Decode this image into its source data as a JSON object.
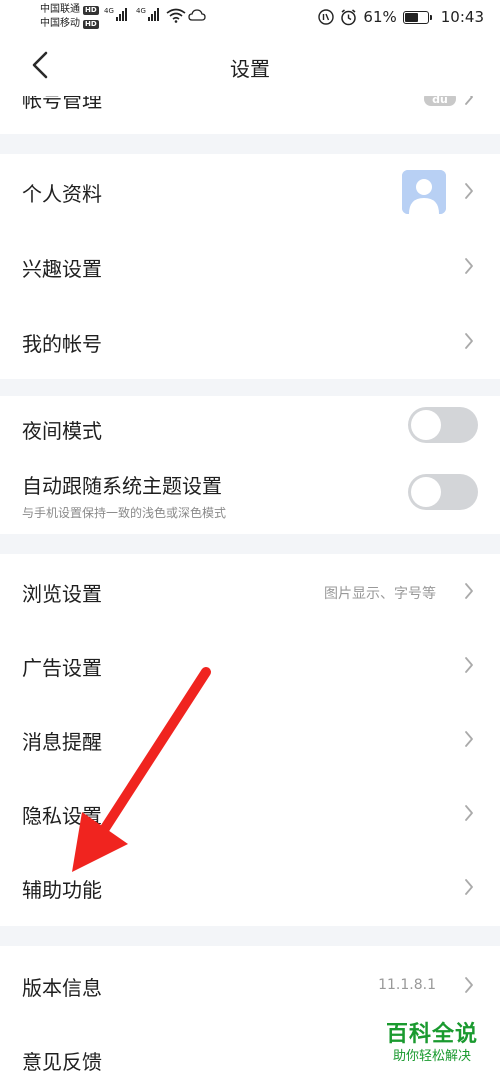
{
  "status_bar": {
    "carrier1": "中国联通",
    "carrier2": "中国移动",
    "hd": "HD",
    "net1": "4G",
    "net2": "4G",
    "battery_percent": "61%",
    "battery_level": 0.61,
    "time": "10:43"
  },
  "nav": {
    "title": "设置"
  },
  "account_group": {
    "partial_label": "帐号管理"
  },
  "profile_group": {
    "items": [
      {
        "label": "个人资料"
      },
      {
        "label": "兴趣设置"
      },
      {
        "label": "我的帐号"
      }
    ]
  },
  "display_group": {
    "night_mode_label": "夜间模式",
    "night_mode_on": false,
    "follow_theme_label": "自动跟随系统主题设置",
    "follow_theme_sub": "与手机设置保持一致的浅色或深色模式",
    "follow_theme_on": false
  },
  "general_group": {
    "items": [
      {
        "label": "浏览设置",
        "value": "图片显示、字号等"
      },
      {
        "label": "广告设置",
        "value": ""
      },
      {
        "label": "消息提醒",
        "value": ""
      },
      {
        "label": "隐私设置",
        "value": ""
      },
      {
        "label": "辅助功能",
        "value": ""
      }
    ]
  },
  "about_group": {
    "items": [
      {
        "label": "版本信息",
        "value": "11.1.8.1"
      },
      {
        "label": "意见反馈",
        "value": ""
      }
    ]
  },
  "watermark": {
    "title": "百科全说",
    "subtitle": "助你轻松解决"
  },
  "colors": {
    "annotation_arrow": "#f0241f",
    "watermark": "#1a9a2f",
    "toggle_off": "#d3d5d8",
    "background": "#f3f5f8"
  }
}
